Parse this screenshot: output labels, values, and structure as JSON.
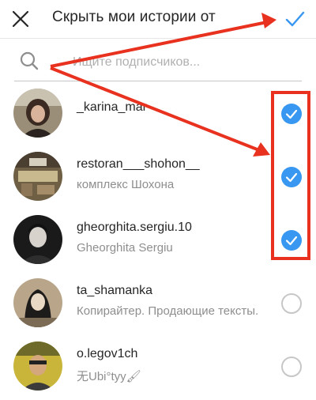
{
  "header": {
    "title": "Скрыть мои истории от",
    "close_icon": "close-icon",
    "done_icon": "checkmark-icon",
    "accent": "#3897f0"
  },
  "search": {
    "placeholder": "Ищите подписчиков...",
    "icon": "search-icon"
  },
  "followers": [
    {
      "username": "_karina_mar",
      "name": "",
      "selected": true
    },
    {
      "username": "restoran___shohon__",
      "name": "комплекс  Шохона",
      "selected": true
    },
    {
      "username": "gheorghita.sergiu.10",
      "name": "Gheorghita Sergiu",
      "selected": true
    },
    {
      "username": "ta_shamanka",
      "name": "Копирайтер. Продающие тексты.",
      "selected": false
    },
    {
      "username": "o.legov1ch",
      "name": "⽆Ubi°tyy🖌",
      "selected": false
    }
  ],
  "annotation": {
    "arrow_color": "#e8321f",
    "highlight_color": "#e8321f"
  }
}
